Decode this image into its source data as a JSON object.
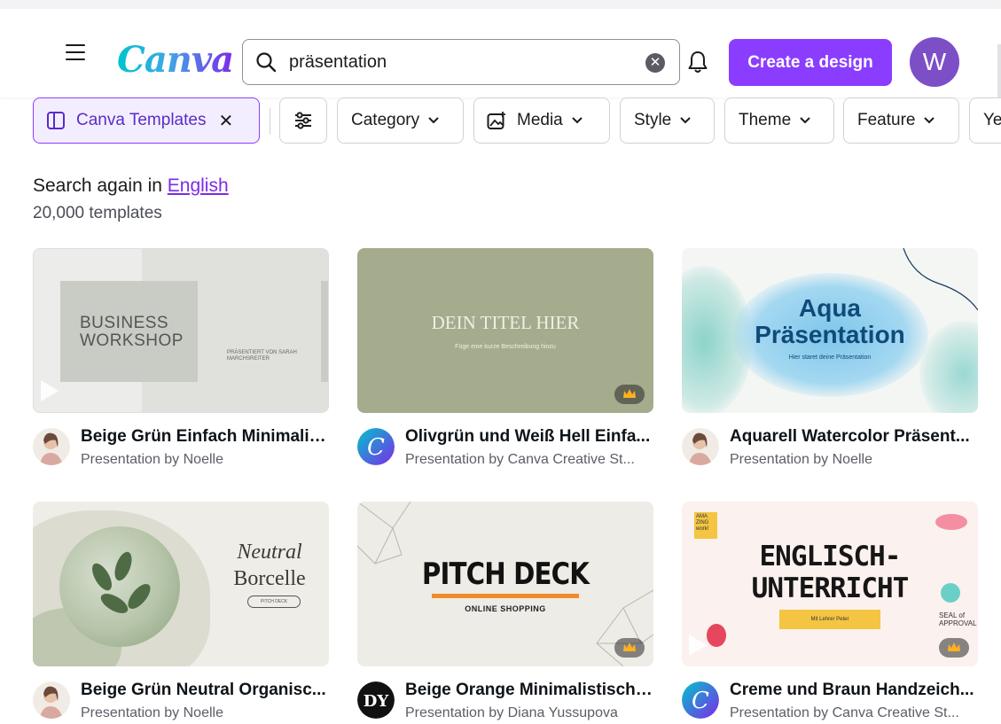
{
  "header": {
    "logo": "Canva",
    "search_value": "präsentation",
    "create_button": "Create a design",
    "user_initial": "W",
    "icons": [
      "menu-icon",
      "search-icon",
      "clear-icon",
      "bell-icon"
    ],
    "brand_color": "#8b3dff"
  },
  "filters": {
    "active_chip": "Canva Templates",
    "chips": [
      "Category",
      "Media",
      "Style",
      "Theme",
      "Feature",
      "Ye"
    ]
  },
  "results": {
    "search_again_prefix": "Search again in",
    "search_again_link": "English",
    "count": "20,000 templates"
  },
  "templates": [
    {
      "title": "Beige Grün Einfach Minimalis...",
      "subtitle": "Presentation by Noelle",
      "thumb": {
        "line1": "BUSINESS",
        "line2": "WORKSHOP",
        "small": "PRÄSENTIERT VON SARAH MARCHSREITER"
      }
    },
    {
      "title": "Olivgrün und Weiß Hell Einfa...",
      "subtitle": "Presentation by Canva Creative St...",
      "thumb": {
        "line1": "DEIN TITEL HIER",
        "small": "Füge eine kurze Beschreibung hinzu"
      }
    },
    {
      "title": "Aquarell Watercolor Präsent...",
      "subtitle": "Presentation by Noelle",
      "thumb": {
        "line1": "Aqua",
        "line2": "Präsentation",
        "small": "Hier staret deine Präsentation"
      }
    },
    {
      "title": "Beige Grün Neutral Organisc...",
      "subtitle": "Presentation by Noelle",
      "thumb": {
        "line1": "Neutral",
        "line2": "Borcelle",
        "small": "PITCH DECK"
      }
    },
    {
      "title": "Beige Orange Minimalistisch ...",
      "subtitle": "Presentation by Diana Yussupova",
      "thumb": {
        "line1": "PITCH DECK",
        "small": "ONLINE SHOPPING"
      }
    },
    {
      "title": "Creme und Braun Handzeich...",
      "subtitle": "Presentation by Canva Creative St...",
      "thumb": {
        "line1": "ENGLISCH-",
        "line2": "UNTERRICHT",
        "small": "Mit Lehrer Peter",
        "sticky": "AMA ZING work!",
        "seal": "SEAL of APPROVAL"
      }
    }
  ]
}
